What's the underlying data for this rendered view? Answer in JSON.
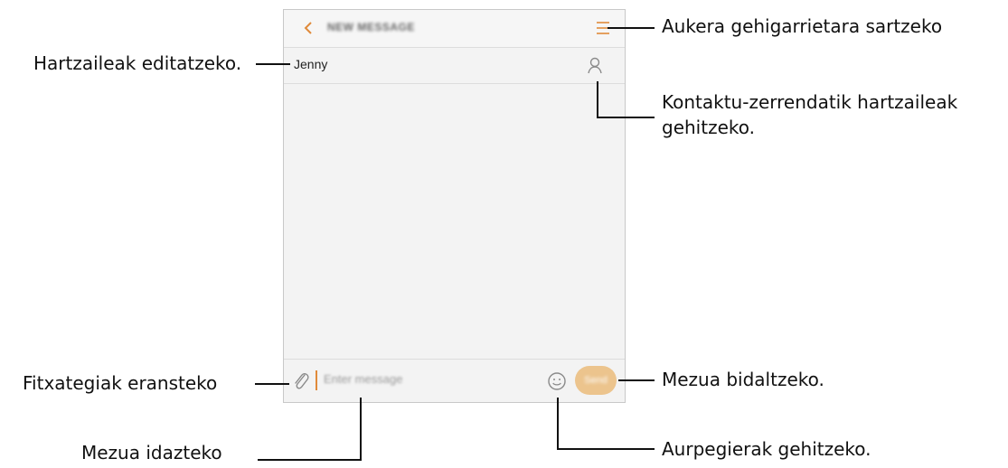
{
  "screen": {
    "title": "NEW MESSAGE",
    "recipient": "Jenny",
    "input_placeholder": "Enter message",
    "send_label": "Send",
    "icons": {
      "back": "chevron-left-icon",
      "menu": "menu-icon",
      "contact": "contact-icon",
      "attach": "paperclip-icon",
      "emoji": "emoji-icon"
    },
    "colors": {
      "accent": "#e08a3a",
      "send_button": "#ecc48d",
      "screen_background": "#f3f3f3"
    }
  },
  "callouts": {
    "more_options": "Aukera gehigarrietara sartzeko",
    "edit_recipients": "Hartzaileak editatzeko.",
    "add_contacts_line1": "Kontaktu-zerrendatik hartzaileak",
    "add_contacts_line2": "gehitzeko.",
    "attach_files": "Fitxategiak eransteko",
    "send_message": "Mezua bidaltzeko.",
    "write_message": "Mezua idazteko",
    "add_emoticons": "Aurpegierak gehitzeko."
  }
}
